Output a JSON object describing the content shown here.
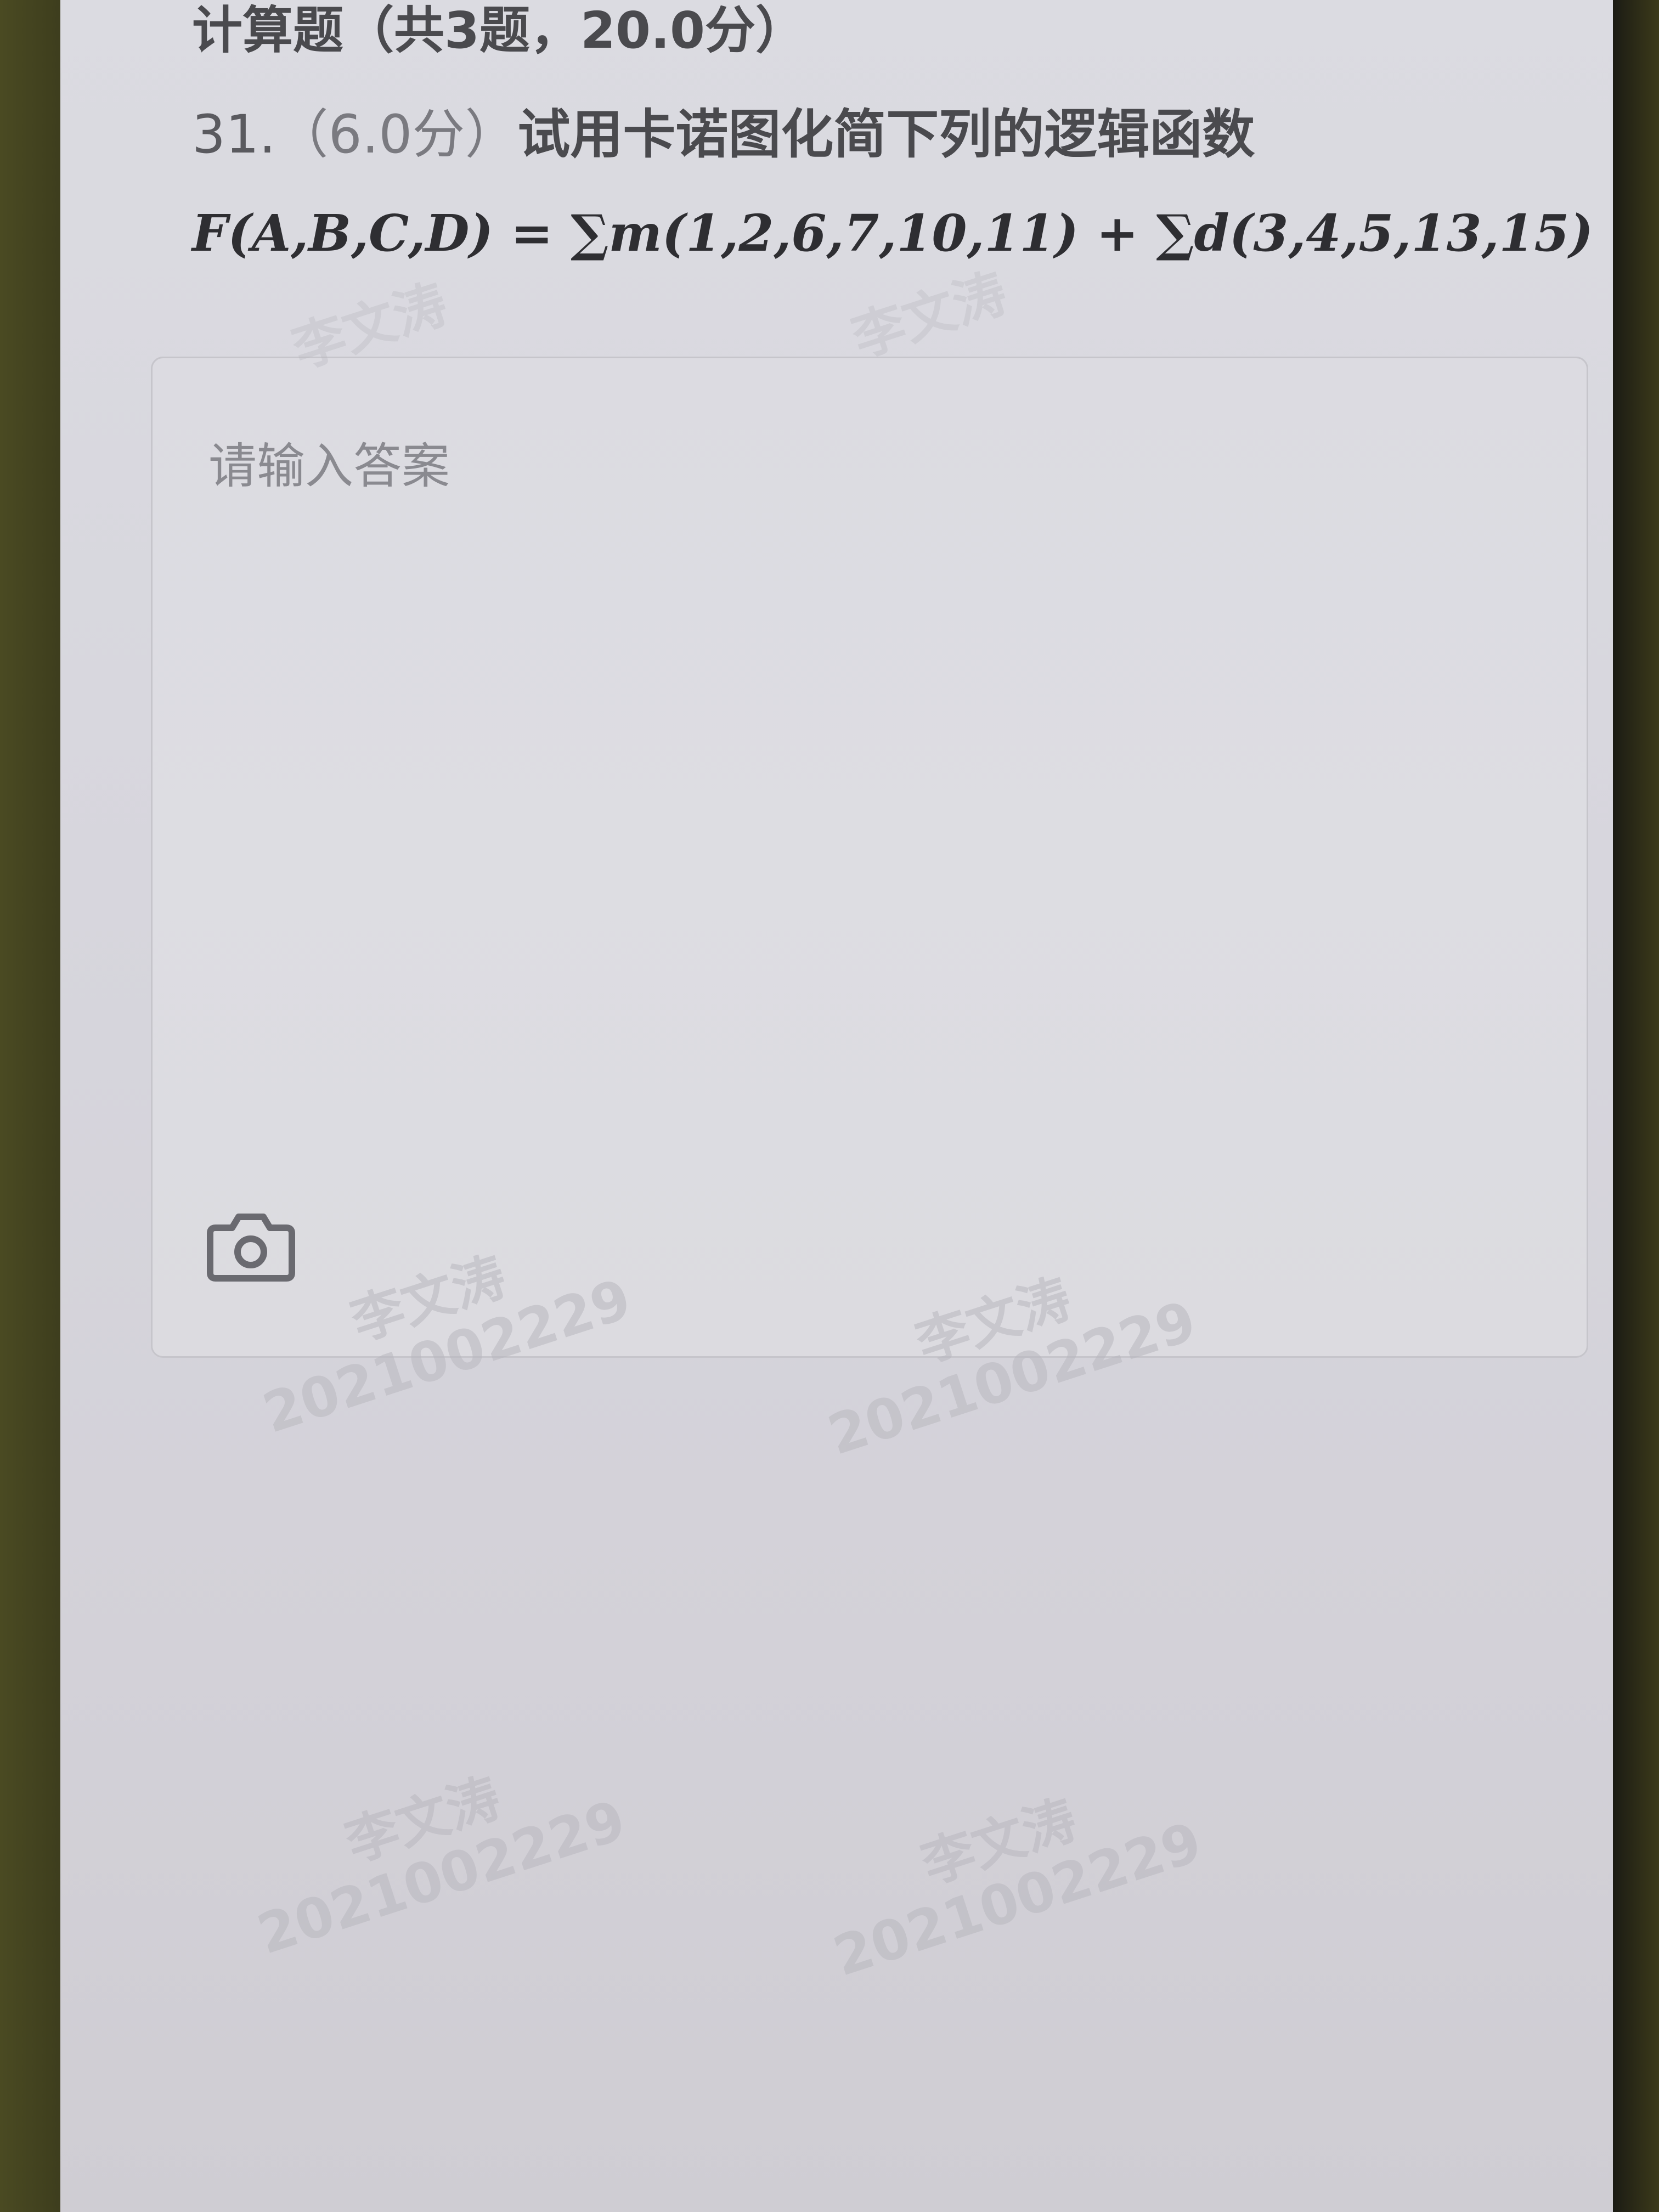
{
  "section": {
    "title": "计算题（共3题，20.0分）"
  },
  "question": {
    "number": "31.",
    "score": "（6.0分）",
    "text": "试用卡诺图化简下列的逻辑函数",
    "formula": "F(A,B,C,D) = ∑m(1,2,6,7,10,11) + ∑d(3,4,5,13,15)"
  },
  "answer": {
    "placeholder": "请输入答案"
  },
  "icons": {
    "camera": "camera-icon"
  },
  "watermark": {
    "name": "李文涛",
    "id": "2021002229"
  }
}
